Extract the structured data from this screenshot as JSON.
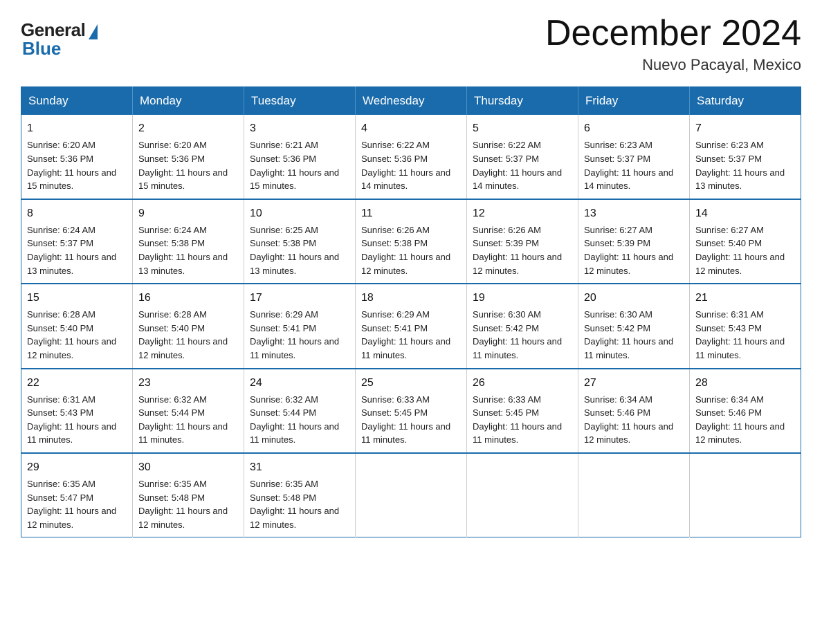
{
  "logo": {
    "general": "General",
    "blue": "Blue"
  },
  "title": "December 2024",
  "location": "Nuevo Pacayal, Mexico",
  "days_of_week": [
    "Sunday",
    "Monday",
    "Tuesday",
    "Wednesday",
    "Thursday",
    "Friday",
    "Saturday"
  ],
  "weeks": [
    [
      {
        "day": "1",
        "sunrise": "6:20 AM",
        "sunset": "5:36 PM",
        "daylight": "11 hours and 15 minutes."
      },
      {
        "day": "2",
        "sunrise": "6:20 AM",
        "sunset": "5:36 PM",
        "daylight": "11 hours and 15 minutes."
      },
      {
        "day": "3",
        "sunrise": "6:21 AM",
        "sunset": "5:36 PM",
        "daylight": "11 hours and 15 minutes."
      },
      {
        "day": "4",
        "sunrise": "6:22 AM",
        "sunset": "5:36 PM",
        "daylight": "11 hours and 14 minutes."
      },
      {
        "day": "5",
        "sunrise": "6:22 AM",
        "sunset": "5:37 PM",
        "daylight": "11 hours and 14 minutes."
      },
      {
        "day": "6",
        "sunrise": "6:23 AM",
        "sunset": "5:37 PM",
        "daylight": "11 hours and 14 minutes."
      },
      {
        "day": "7",
        "sunrise": "6:23 AM",
        "sunset": "5:37 PM",
        "daylight": "11 hours and 13 minutes."
      }
    ],
    [
      {
        "day": "8",
        "sunrise": "6:24 AM",
        "sunset": "5:37 PM",
        "daylight": "11 hours and 13 minutes."
      },
      {
        "day": "9",
        "sunrise": "6:24 AM",
        "sunset": "5:38 PM",
        "daylight": "11 hours and 13 minutes."
      },
      {
        "day": "10",
        "sunrise": "6:25 AM",
        "sunset": "5:38 PM",
        "daylight": "11 hours and 13 minutes."
      },
      {
        "day": "11",
        "sunrise": "6:26 AM",
        "sunset": "5:38 PM",
        "daylight": "11 hours and 12 minutes."
      },
      {
        "day": "12",
        "sunrise": "6:26 AM",
        "sunset": "5:39 PM",
        "daylight": "11 hours and 12 minutes."
      },
      {
        "day": "13",
        "sunrise": "6:27 AM",
        "sunset": "5:39 PM",
        "daylight": "11 hours and 12 minutes."
      },
      {
        "day": "14",
        "sunrise": "6:27 AM",
        "sunset": "5:40 PM",
        "daylight": "11 hours and 12 minutes."
      }
    ],
    [
      {
        "day": "15",
        "sunrise": "6:28 AM",
        "sunset": "5:40 PM",
        "daylight": "11 hours and 12 minutes."
      },
      {
        "day": "16",
        "sunrise": "6:28 AM",
        "sunset": "5:40 PM",
        "daylight": "11 hours and 12 minutes."
      },
      {
        "day": "17",
        "sunrise": "6:29 AM",
        "sunset": "5:41 PM",
        "daylight": "11 hours and 11 minutes."
      },
      {
        "day": "18",
        "sunrise": "6:29 AM",
        "sunset": "5:41 PM",
        "daylight": "11 hours and 11 minutes."
      },
      {
        "day": "19",
        "sunrise": "6:30 AM",
        "sunset": "5:42 PM",
        "daylight": "11 hours and 11 minutes."
      },
      {
        "day": "20",
        "sunrise": "6:30 AM",
        "sunset": "5:42 PM",
        "daylight": "11 hours and 11 minutes."
      },
      {
        "day": "21",
        "sunrise": "6:31 AM",
        "sunset": "5:43 PM",
        "daylight": "11 hours and 11 minutes."
      }
    ],
    [
      {
        "day": "22",
        "sunrise": "6:31 AM",
        "sunset": "5:43 PM",
        "daylight": "11 hours and 11 minutes."
      },
      {
        "day": "23",
        "sunrise": "6:32 AM",
        "sunset": "5:44 PM",
        "daylight": "11 hours and 11 minutes."
      },
      {
        "day": "24",
        "sunrise": "6:32 AM",
        "sunset": "5:44 PM",
        "daylight": "11 hours and 11 minutes."
      },
      {
        "day": "25",
        "sunrise": "6:33 AM",
        "sunset": "5:45 PM",
        "daylight": "11 hours and 11 minutes."
      },
      {
        "day": "26",
        "sunrise": "6:33 AM",
        "sunset": "5:45 PM",
        "daylight": "11 hours and 11 minutes."
      },
      {
        "day": "27",
        "sunrise": "6:34 AM",
        "sunset": "5:46 PM",
        "daylight": "11 hours and 12 minutes."
      },
      {
        "day": "28",
        "sunrise": "6:34 AM",
        "sunset": "5:46 PM",
        "daylight": "11 hours and 12 minutes."
      }
    ],
    [
      {
        "day": "29",
        "sunrise": "6:35 AM",
        "sunset": "5:47 PM",
        "daylight": "11 hours and 12 minutes."
      },
      {
        "day": "30",
        "sunrise": "6:35 AM",
        "sunset": "5:48 PM",
        "daylight": "11 hours and 12 minutes."
      },
      {
        "day": "31",
        "sunrise": "6:35 AM",
        "sunset": "5:48 PM",
        "daylight": "11 hours and 12 minutes."
      },
      null,
      null,
      null,
      null
    ]
  ]
}
